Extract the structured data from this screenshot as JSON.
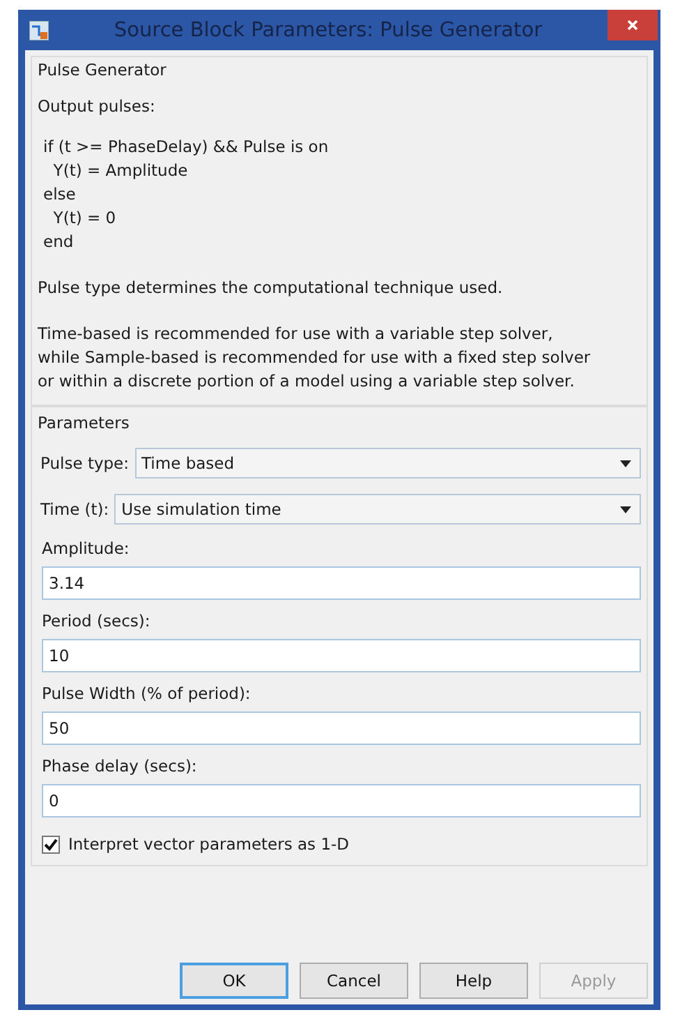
{
  "window": {
    "title": "Source Block Parameters: Pulse Generator"
  },
  "description": {
    "title": "Pulse Generator",
    "heading": "Output pulses:",
    "code_lines": [
      "if (t >= PhaseDelay) && Pulse is on",
      "  Y(t) = Amplitude",
      "else",
      "  Y(t) = 0",
      "end"
    ],
    "paragraphs": [
      "Pulse type determines the computational technique used.",
      "Time-based is recommended for use with a variable step solver, while Sample-based is recommended for use with a fixed step solver or within a discrete portion of a model using a variable step solver."
    ]
  },
  "parameters": {
    "title": "Parameters",
    "fields": [
      {
        "kind": "dropdown",
        "label": "Pulse type:",
        "value": "Time based"
      },
      {
        "kind": "dropdown",
        "label": "Time (t):",
        "value": "Use simulation time"
      },
      {
        "kind": "edit",
        "label": "Amplitude:",
        "value": "3.14"
      },
      {
        "kind": "edit",
        "label": "Period (secs):",
        "value": "10"
      },
      {
        "kind": "edit",
        "label": "Pulse Width (% of period):",
        "value": "50"
      },
      {
        "kind": "edit",
        "label": "Phase delay (secs):",
        "value": "0"
      },
      {
        "kind": "checkbox",
        "label": "Interpret vector parameters as 1-D",
        "checked": true
      }
    ]
  },
  "buttons": [
    {
      "label": "OK",
      "default": true,
      "disabled": false
    },
    {
      "label": "Cancel",
      "default": false,
      "disabled": false
    },
    {
      "label": "Help",
      "default": false,
      "disabled": false
    },
    {
      "label": "Apply",
      "default": false,
      "disabled": true
    }
  ]
}
